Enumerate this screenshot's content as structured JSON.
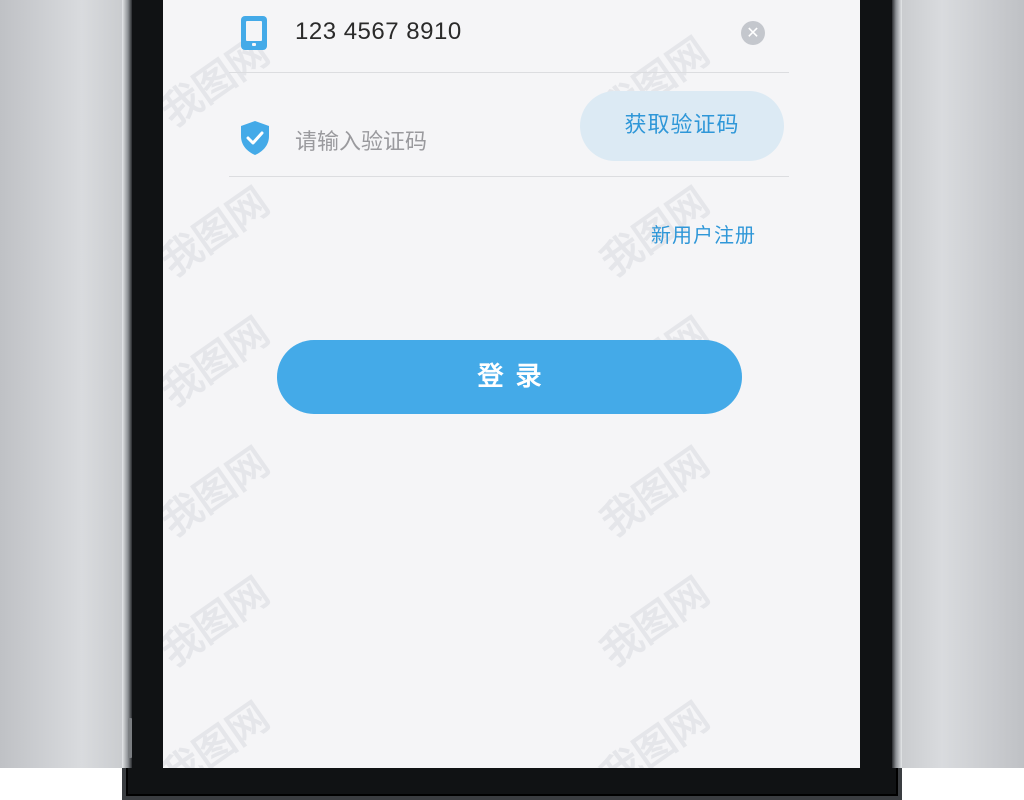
{
  "colors": {
    "accent": "#44aae8",
    "accent_text": "#2f97d8",
    "get_code_bg": "#dceaf4",
    "screen_bg": "#f5f5f7",
    "divider": "#dcdde0"
  },
  "watermark": {
    "text": "我图网"
  },
  "login_form": {
    "phone": {
      "icon": "phone-icon",
      "value": "123 4567 8910",
      "clear_icon": "close-icon",
      "clear_symbol": "✕"
    },
    "code": {
      "icon": "shield-check-icon",
      "placeholder": "请输入验证码",
      "value": "",
      "get_code_label": "获取验证码"
    },
    "register_label": "新用户注册",
    "login_label": "登录"
  }
}
